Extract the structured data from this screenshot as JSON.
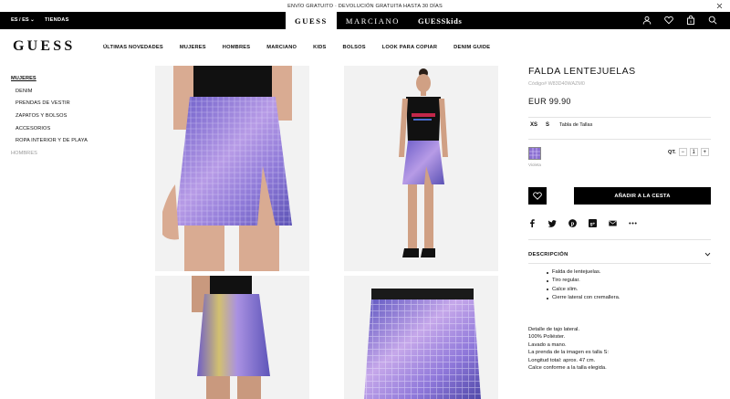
{
  "promo": {
    "text": "ENVÍO GRATUITO  ·  DEVOLUCIÓN GRATUITA HASTA 30 DÍAS",
    "close_icon": "close-icon"
  },
  "topbar": {
    "lang": "ES / ES",
    "stores": "TIENDAS",
    "brands": [
      "GUESS",
      "MARCIANO",
      "GUESSkids"
    ],
    "icons": [
      "user-icon",
      "heart-icon",
      "bag-icon",
      "search-icon"
    ]
  },
  "logo": "GUESS",
  "nav": [
    "ÚLTIMAS NOVEDADES",
    "MUJERES",
    "HOMBRES",
    "MARCIANO",
    "KIDS",
    "BOLSOS",
    "LOOK PARA COPIAR",
    "DENIM GUIDE"
  ],
  "sidebar": {
    "items": [
      "MUJERES",
      "DENIM",
      "PRENDAS DE VESTIR",
      "ZAPATOS Y BOLSOS",
      "ACCESORIOS",
      "ROPA INTERIOR Y DE PLAYA",
      "HOMBRES"
    ]
  },
  "product": {
    "title": "FALDA LENTEJUELAS",
    "code": "Código# W83D40WAZM0",
    "price": "EUR 99.90",
    "sizes": [
      "XS",
      "S"
    ],
    "size_guide": "Tabla de Tallas",
    "color_label": "Violeta",
    "qty_label": "QT.",
    "qty_minus": "−",
    "qty_value": "1",
    "qty_plus": "+",
    "add_to_cart": "AÑADIR A LA CESTA",
    "share_icons": [
      "facebook-icon",
      "twitter-icon",
      "pinterest-icon",
      "googleplus-icon",
      "email-icon",
      "more-icon"
    ],
    "description_label": "DESCRIPCIÓN",
    "bullets": [
      "Falda de lentejuelas.",
      "Tiro regular.",
      "Calce slim.",
      "Cierre lateral con cremallera."
    ],
    "details": [
      "Detalle de tajo lateral.",
      "100% Poliéster.",
      "Lavado a mano.",
      "La prenda de la imagen es talla S:",
      "Longitud total: aprox. 47 cm.",
      "Calce conforme a la talla elegida."
    ]
  },
  "colors": {
    "black": "#000000",
    "skirt_purple": "#8a6fd0",
    "skirt_pink": "#d8a8e0"
  }
}
